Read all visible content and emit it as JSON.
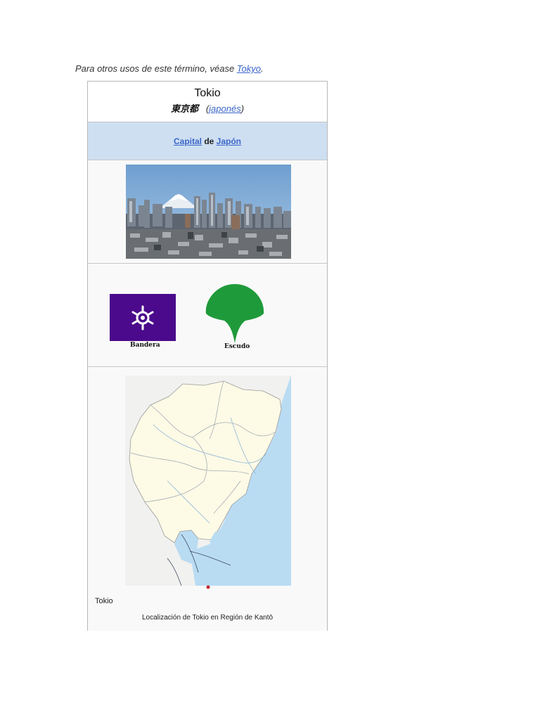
{
  "hatnote": {
    "prefix": "Para otros usos de este término, véase ",
    "link": "Tokyo",
    "suffix": "."
  },
  "infobox": {
    "title": "Tokio",
    "native_name": "東京都",
    "lang_open": "(",
    "lang_link": "japonés",
    "lang_close": ")",
    "caption_link1": "Capital",
    "caption_mid": " de ",
    "caption_link2": "Japón",
    "flag_label": "Bandera",
    "shield_label": "Escudo",
    "map_label": "Tokio",
    "map_caption": "Localización de Tokio en Región de Kantō"
  },
  "colors": {
    "link": "#3a66c8",
    "caption_band": "#cedff2",
    "flag_purple": "#4b0a8c",
    "shield_green": "#1f9a3a",
    "map_land": "#fdfae6",
    "map_water": "#b9dcf3"
  }
}
